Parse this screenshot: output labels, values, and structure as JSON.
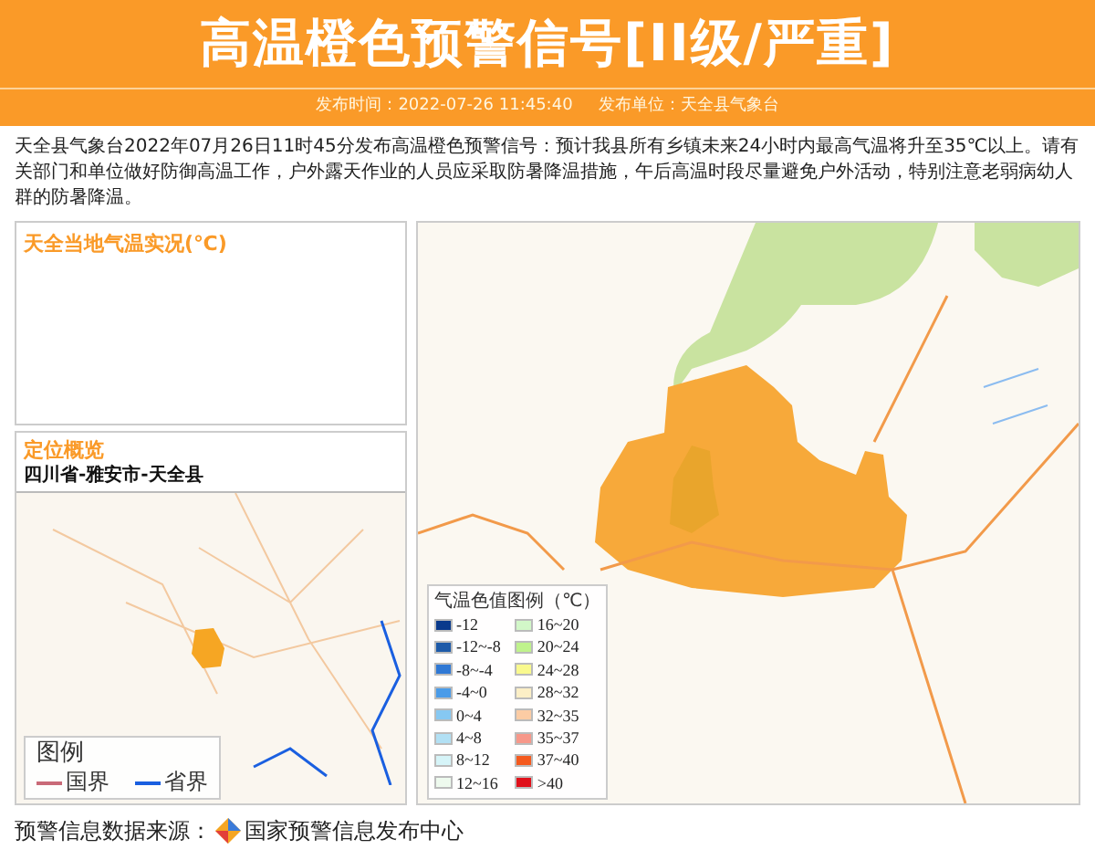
{
  "header": {
    "title": "高温橙色预警信号[II级/严重]",
    "time_label": "发布时间：2022-07-26 11:45:40",
    "unit_label": "发布单位：天全县气象台"
  },
  "body": "天全县气象台2022年07月26日11时45分发布高温橙色预警信号：预计我县所有乡镇未来24小时内最高气温将升至35℃以上。请有关部门和单位做好防御高温工作，户外露天作业的人员应采取防暑降温措施，午后高温时段尽量避免户外活动，特别注意老弱病幼人群的防暑降温。",
  "temp_panel": {
    "title": "天全当地气温实况(℃)"
  },
  "location_panel": {
    "title": "定位概览",
    "path": "四川省-雅安市-天全县",
    "legend": {
      "title": "图例",
      "items": [
        {
          "label": "国界",
          "color": "#c96a78"
        },
        {
          "label": "省界",
          "color": "#1a5fe0"
        }
      ]
    }
  },
  "map_legend": {
    "title": "气温色值图例（℃）",
    "items": [
      {
        "label": "-12",
        "color": "#0a3a8c"
      },
      {
        "label": "-12~-8",
        "color": "#1e5aa8"
      },
      {
        "label": "-8~-4",
        "color": "#2f78d4"
      },
      {
        "label": "-4~0",
        "color": "#4a9be8"
      },
      {
        "label": "0~4",
        "color": "#86c8f2"
      },
      {
        "label": "4~8",
        "color": "#b2e0f4"
      },
      {
        "label": "8~12",
        "color": "#d6f4f8"
      },
      {
        "label": "12~16",
        "color": "#eefaee"
      },
      {
        "label": "16~20",
        "color": "#d2f7c8"
      },
      {
        "label": "20~24",
        "color": "#bff28c"
      },
      {
        "label": "24~28",
        "color": "#f9f98e"
      },
      {
        "label": "28~32",
        "color": "#fcefc6"
      },
      {
        "label": "32~35",
        "color": "#fccca4"
      },
      {
        "label": "35~37",
        "color": "#f7988a"
      },
      {
        "label": "37~40",
        "color": "#f45a1e"
      },
      {
        "label": ">40",
        "color": "#e0101a"
      }
    ]
  },
  "footer": {
    "label": "预警信息数据来源：",
    "source": "国家预警信息发布中心"
  }
}
